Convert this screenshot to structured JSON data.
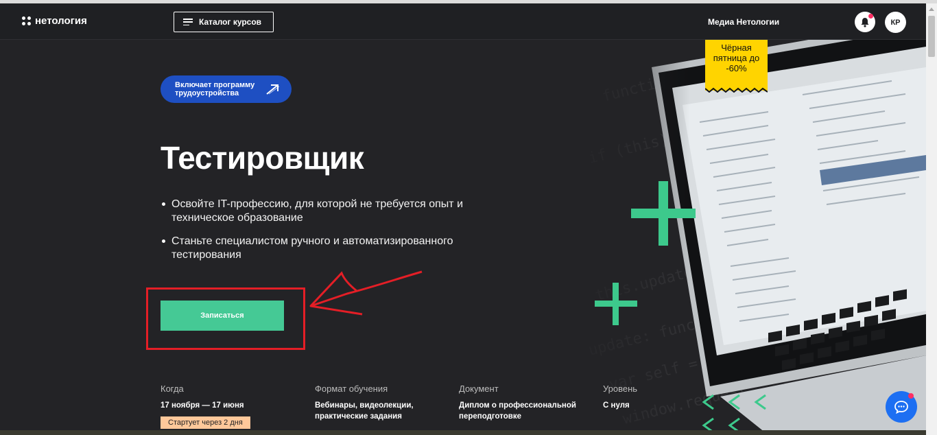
{
  "header": {
    "logo_text": "нетология",
    "catalog_label": "Каталог курсов",
    "media_label": "Медиа Нетологии",
    "avatar_initials": "КР"
  },
  "hero": {
    "badge_text": "Включает программу трудоустройства",
    "title": "Тестировщик",
    "bullets": [
      "Освойте IT-профессию, для которой не требуется опыт и техническое образование",
      "Станьте специалистом ручного и автоматизированного тестирования"
    ],
    "enroll_label": "Записаться"
  },
  "promo": {
    "text": "Чёрная пятница до -60%",
    "color": "#ffd400"
  },
  "facts": [
    {
      "label": "Когда",
      "value": "17 ноября — 17 июня"
    },
    {
      "label": "Формат обучения",
      "value": "Вебинары, видеолекции, практические задания"
    },
    {
      "label": "Документ",
      "value": "Диплом о профессиональной переподготовке"
    },
    {
      "label": "Уровень",
      "value": "С нуля"
    }
  ],
  "starts_text": "Стартует через 2 дня",
  "colors": {
    "accent_green": "#45c995",
    "badge_blue": "#1e4fc2",
    "annotation_red": "#e41e26",
    "chat_blue": "#1d6ff2"
  },
  "icons": [
    "bell-icon",
    "chat-icon",
    "arrow-icon",
    "burger-icon",
    "logo-icon"
  ]
}
